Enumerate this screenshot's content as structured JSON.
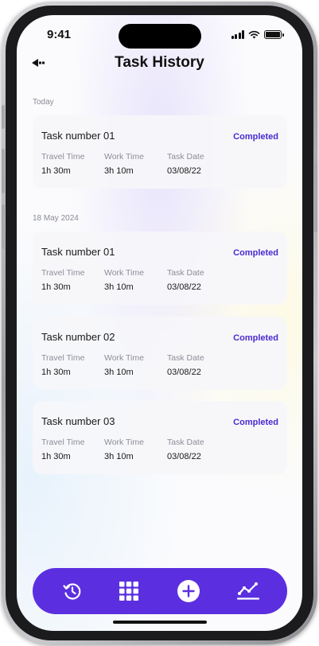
{
  "status_bar": {
    "time": "9:41"
  },
  "header": {
    "title": "Task History",
    "back_icon": "back-arrow-icon"
  },
  "sections": [
    {
      "label": "Today",
      "tasks": [
        {
          "title": "Task number 01",
          "status": "Completed",
          "fields": [
            {
              "label": "Travel Time",
              "value": "1h 30m"
            },
            {
              "label": "Work Time",
              "value": "3h 10m"
            },
            {
              "label": "Task Date",
              "value": "03/08/22"
            }
          ]
        }
      ]
    },
    {
      "label": "18 May 2024",
      "tasks": [
        {
          "title": "Task number 01",
          "status": "Completed",
          "fields": [
            {
              "label": "Travel Time",
              "value": "1h 30m"
            },
            {
              "label": "Work Time",
              "value": "3h 10m"
            },
            {
              "label": "Task Date",
              "value": "03/08/22"
            }
          ]
        },
        {
          "title": "Task number 02",
          "status": "Completed",
          "fields": [
            {
              "label": "Travel Time",
              "value": "1h 30m"
            },
            {
              "label": "Work Time",
              "value": "3h 10m"
            },
            {
              "label": "Task Date",
              "value": "03/08/22"
            }
          ]
        },
        {
          "title": "Task number 03",
          "status": "Completed",
          "fields": [
            {
              "label": "Travel Time",
              "value": "1h 30m"
            },
            {
              "label": "Work Time",
              "value": "3h 10m"
            },
            {
              "label": "Task Date",
              "value": "03/08/22"
            }
          ]
        }
      ]
    }
  ],
  "bottom_nav": {
    "items": [
      "history-icon",
      "grid-icon",
      "add-icon",
      "chart-icon"
    ]
  },
  "colors": {
    "accent": "#5b2fe0",
    "status_completed": "#4a2ad1"
  }
}
